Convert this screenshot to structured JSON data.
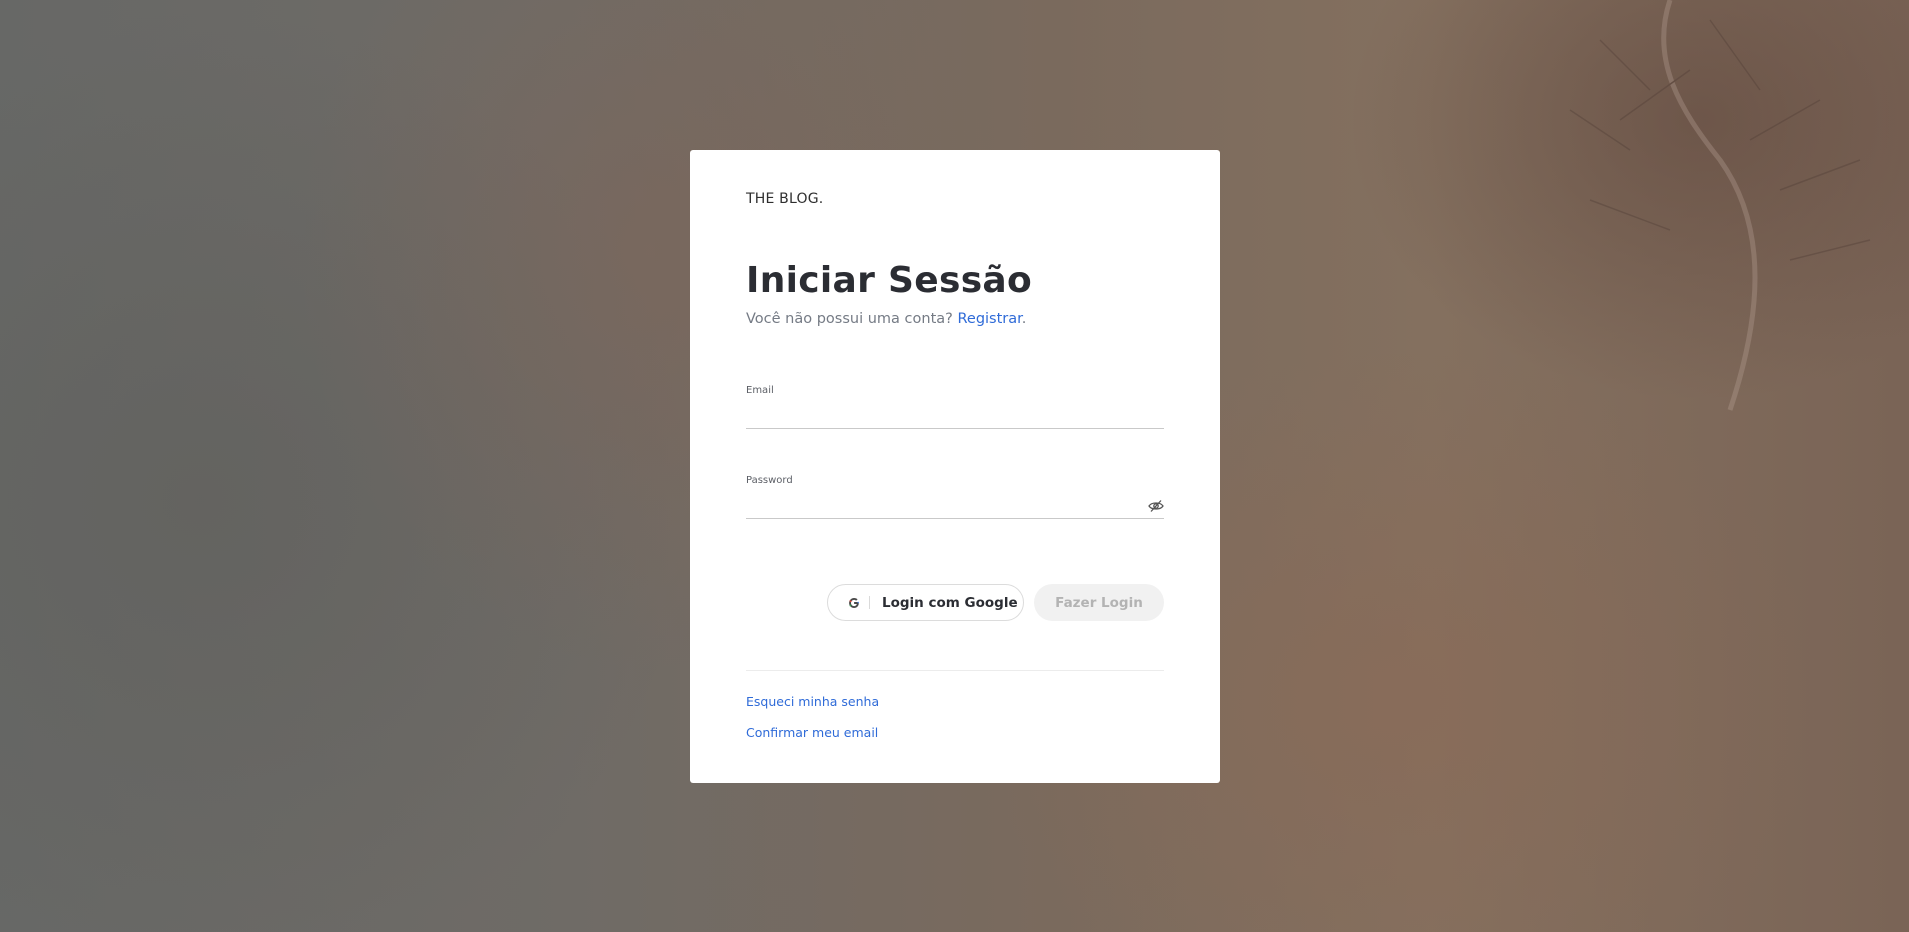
{
  "brand": "THE BLOG.",
  "login": {
    "title": "Iniciar Sessão",
    "subtitle_text": "Você não possui uma conta?",
    "register_link": "Registrar",
    "subtitle_end": ".",
    "email": {
      "label": "Email",
      "value": ""
    },
    "password": {
      "label": "Password",
      "value": ""
    },
    "google_button_label": "Login com Google",
    "login_button_label": "Fazer Login",
    "forgot_password_link": "Esqueci minha senha",
    "confirm_email_link": "Confirmar meu email"
  },
  "icons": {
    "google": "google-icon",
    "password_visibility": "eye-off-icon"
  },
  "colors": {
    "link": "#2f6bd8",
    "title": "#2b2d33",
    "card_bg": "#ffffff",
    "disabled_button_bg": "#f1f1f1",
    "disabled_button_text": "#b3b3b3"
  }
}
